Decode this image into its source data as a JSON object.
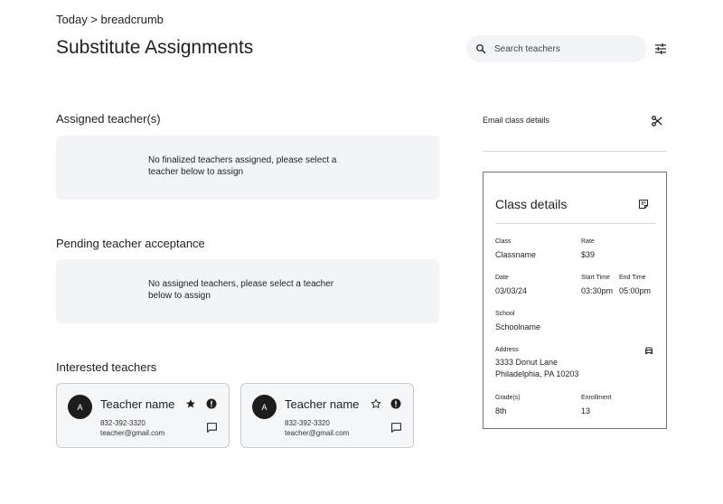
{
  "breadcrumb": "Today > breadcrumb",
  "page_title": "Substitute Assignments",
  "search": {
    "placeholder": "Search teachers"
  },
  "assigned": {
    "title": "Assigned teacher(s)",
    "empty_message": "No finalized teachers assigned, please select a teacher below to assign"
  },
  "pending": {
    "title": "Pending teacher acceptance",
    "empty_message": "No assigned teachers, please select a teacher below to assign"
  },
  "interested": {
    "title": "Interested teachers",
    "teachers": [
      {
        "initial": "A",
        "name": "Teacher name",
        "phone": "832-392-3320",
        "email": "teacher@gmail.com",
        "starred": true
      },
      {
        "initial": "A",
        "name": "Teacher name",
        "phone": "832-392-3320",
        "email": "teacher@gmail.com",
        "starred": false
      }
    ]
  },
  "email_class_details": "Email class details",
  "class_details": {
    "title": "Class details",
    "class_label": "Class",
    "class_value": "Classname",
    "rate_label": "Rate",
    "rate_value": "$39",
    "date_label": "Date",
    "date_value": "03/03/24",
    "start_label": "Start Time",
    "start_value": "03:30pm",
    "end_label": "End Time",
    "end_value": "05:00pm",
    "school_label": "School",
    "school_value": "Schoolname",
    "address_label": "Address",
    "address_line1": "3333 Donut Lane",
    "address_line2": "Philadelphia, PA 10203",
    "grade_label": "Grade(s)",
    "grade_value": "8th",
    "enrollment_label": "Enrollment",
    "enrollment_value": "13"
  },
  "colors": {
    "panel_bg": "#f2f4f8",
    "card_border": "#c8ccd2",
    "text": "#1f1f1f",
    "avatar": "#1d1d1d"
  }
}
